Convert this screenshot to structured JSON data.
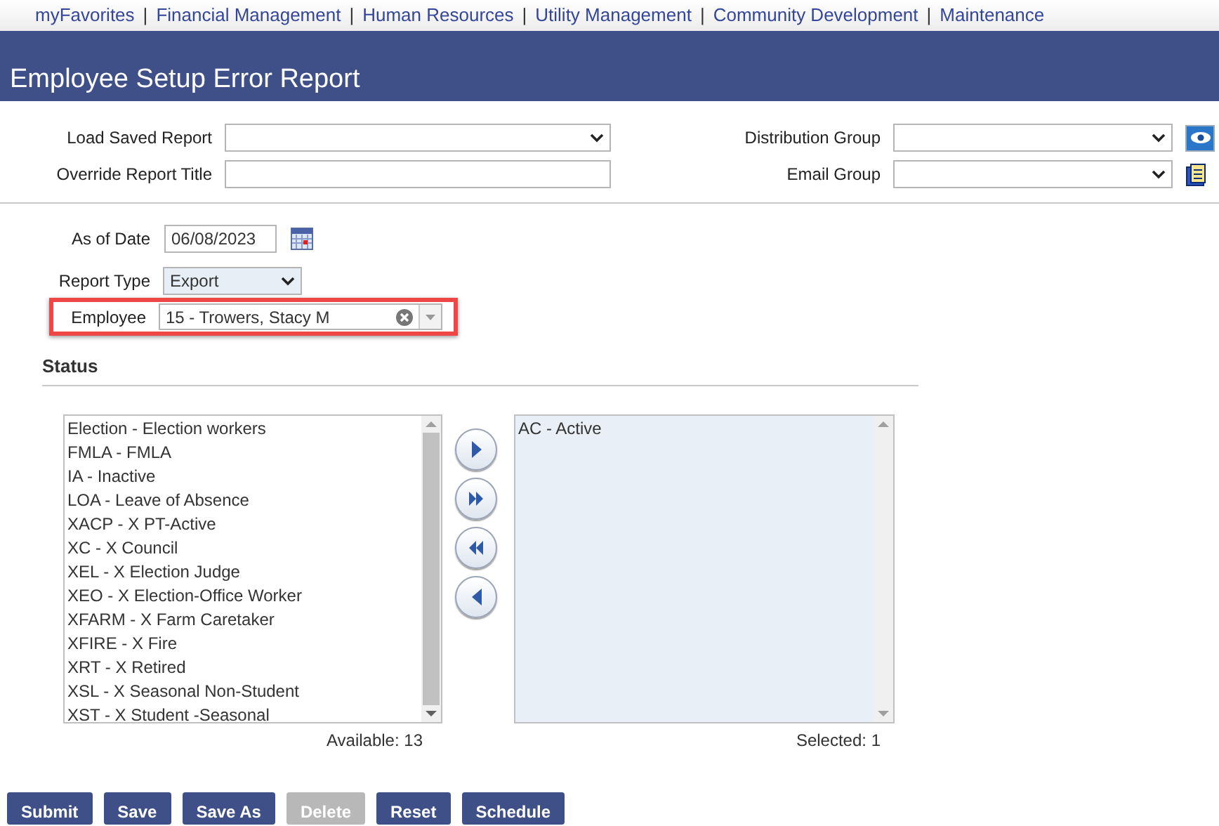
{
  "nav": [
    "myFavorites",
    "Financial Management",
    "Human Resources",
    "Utility Management",
    "Community Development",
    "Maintenance"
  ],
  "nav_separator": "|",
  "title": "Employee Setup Error Report",
  "load_saved_report": {
    "label": "Load Saved Report"
  },
  "override_report_title": {
    "label": "Override Report Title"
  },
  "distribution_group": {
    "label": "Distribution Group"
  },
  "email_group": {
    "label": "Email Group"
  },
  "as_of_date": {
    "label": "As of Date",
    "value": "06/08/2023"
  },
  "report_type": {
    "label": "Report Type",
    "value": "Export"
  },
  "employee": {
    "label": "Employee",
    "value": "15 - Trowers, Stacy M",
    "highlighted": true
  },
  "status": {
    "heading": "Status",
    "available": [
      "Election - Election workers",
      "FMLA - FMLA",
      "IA - Inactive",
      "LOA - Leave of Absence",
      "XACP - X PT-Active",
      "XC - X Council",
      "XEL - X Election Judge",
      "XEO - X Election-Office Worker",
      "XFARM - X Farm Caretaker",
      "XFIRE - X Fire",
      "XRT - X Retired",
      "XSL - X Seasonal Non-Student",
      "XST - X Student -Seasonal"
    ],
    "selected": [
      "AC - Active"
    ],
    "available_count": "Available: 13",
    "selected_count": "Selected: 1"
  },
  "buttons": [
    {
      "label": "Submit",
      "disabled": false
    },
    {
      "label": "Save",
      "disabled": false
    },
    {
      "label": "Save As",
      "disabled": false
    },
    {
      "label": "Delete",
      "disabled": true
    },
    {
      "label": "Reset",
      "disabled": false
    },
    {
      "label": "Schedule",
      "disabled": false
    }
  ]
}
